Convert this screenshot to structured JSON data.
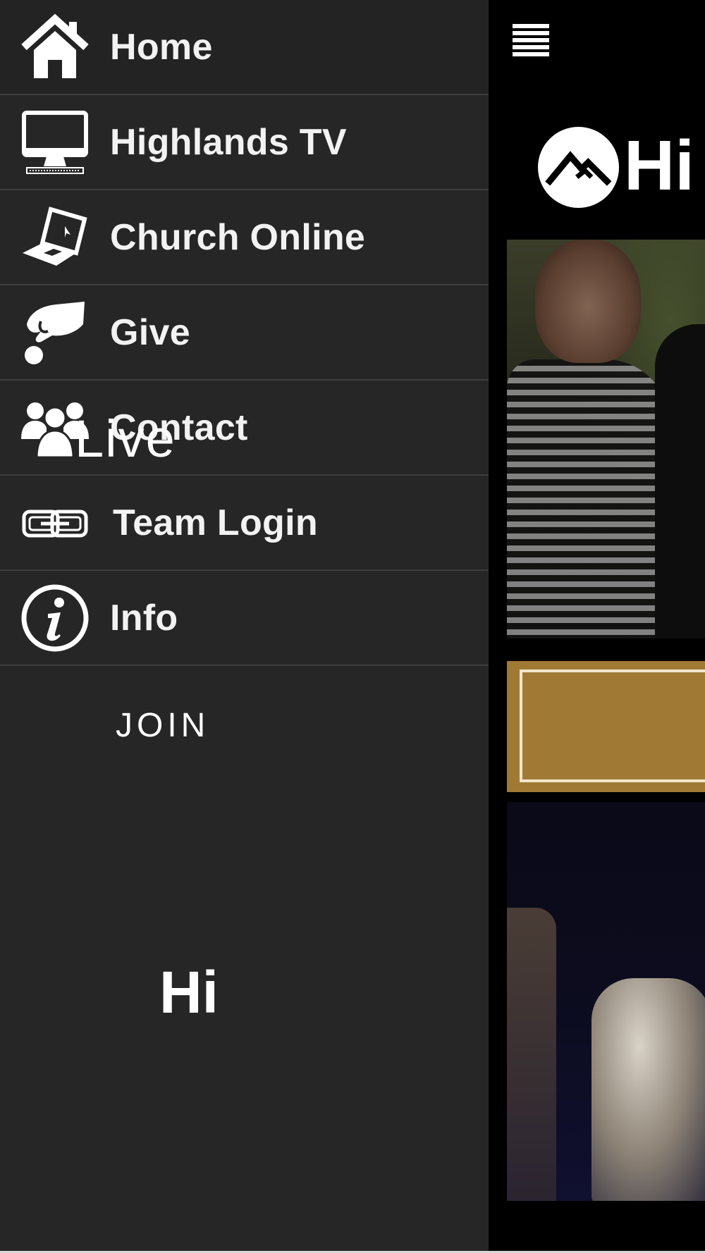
{
  "menu": {
    "items": [
      {
        "label": "Home",
        "icon": "home-icon"
      },
      {
        "label": "Highlands TV",
        "icon": "desktop-monitor-icon"
      },
      {
        "label": "Church Online",
        "icon": "laptop-icon"
      },
      {
        "label": "Give",
        "icon": "hand-coin-icon"
      },
      {
        "label": "Contact",
        "icon": "users-group-icon"
      },
      {
        "label": "Team Login",
        "icon": "link-icon"
      },
      {
        "label": "Info",
        "icon": "info-icon"
      }
    ]
  },
  "header": {
    "menu_icon": "hamburger-icon",
    "logo_text": "Hi"
  },
  "content": {
    "hero_text": "Live",
    "join_label": "JOIN",
    "hero2_text": "Hi"
  },
  "colors": {
    "drawer_bg": "#262626",
    "join_gold": "#a07a35"
  }
}
